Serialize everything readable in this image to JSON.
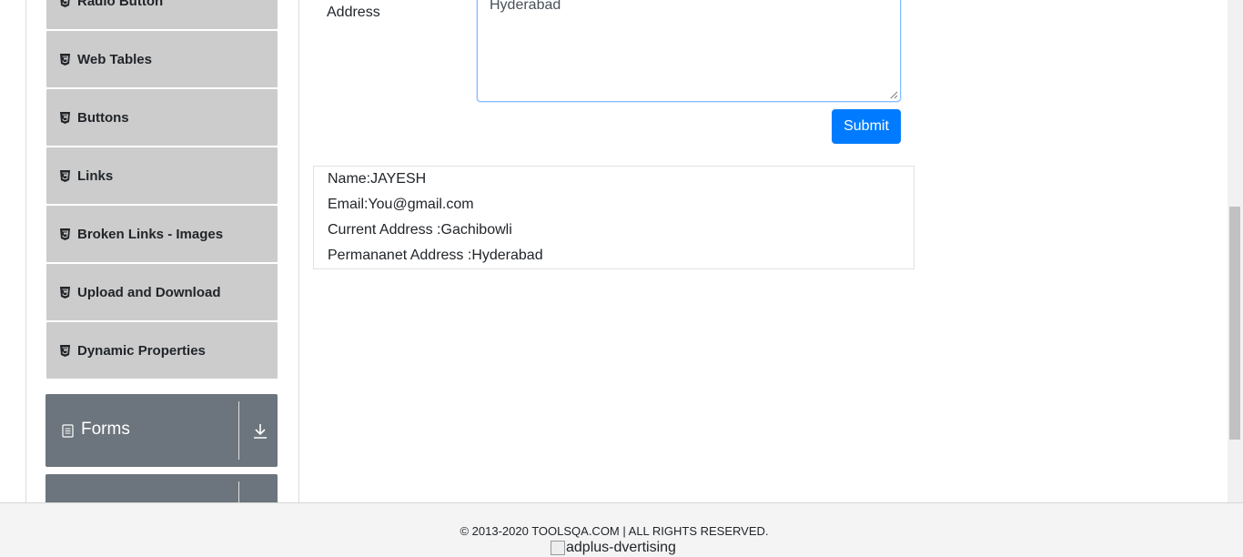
{
  "sidebar": {
    "items": [
      {
        "label": "Radio Button",
        "icon": "html5-icon"
      },
      {
        "label": "Web Tables",
        "icon": "html5-icon"
      },
      {
        "label": "Buttons",
        "icon": "html5-icon"
      },
      {
        "label": "Links",
        "icon": "html5-icon"
      },
      {
        "label": "Broken Links - Images",
        "icon": "html5-icon"
      },
      {
        "label": "Upload and Download",
        "icon": "html5-icon"
      },
      {
        "label": "Dynamic Properties",
        "icon": "html5-icon"
      }
    ],
    "groups": [
      {
        "label": "Forms",
        "icon": "document-icon"
      },
      {
        "label": "",
        "icon": ""
      }
    ]
  },
  "form": {
    "address_label": "Address",
    "permanent_address_value": "Hyderabad",
    "submit_label": "Submit"
  },
  "output": {
    "name": "Name:JAYESH",
    "email": "Email:You@gmail.com",
    "current_address": "Current Address :Gachibowli",
    "permanent_address": "Permananet Address :Hyderabad"
  },
  "footer": {
    "copyright": "© 2013-2020 TOOLSQA.COM | ALL RIGHTS RESERVED.",
    "ad_alt": "adplus-dvertising"
  },
  "colors": {
    "primary": "#007bff",
    "menu_item_bg": "#cccccc",
    "group_header_bg": "#6c757d"
  }
}
